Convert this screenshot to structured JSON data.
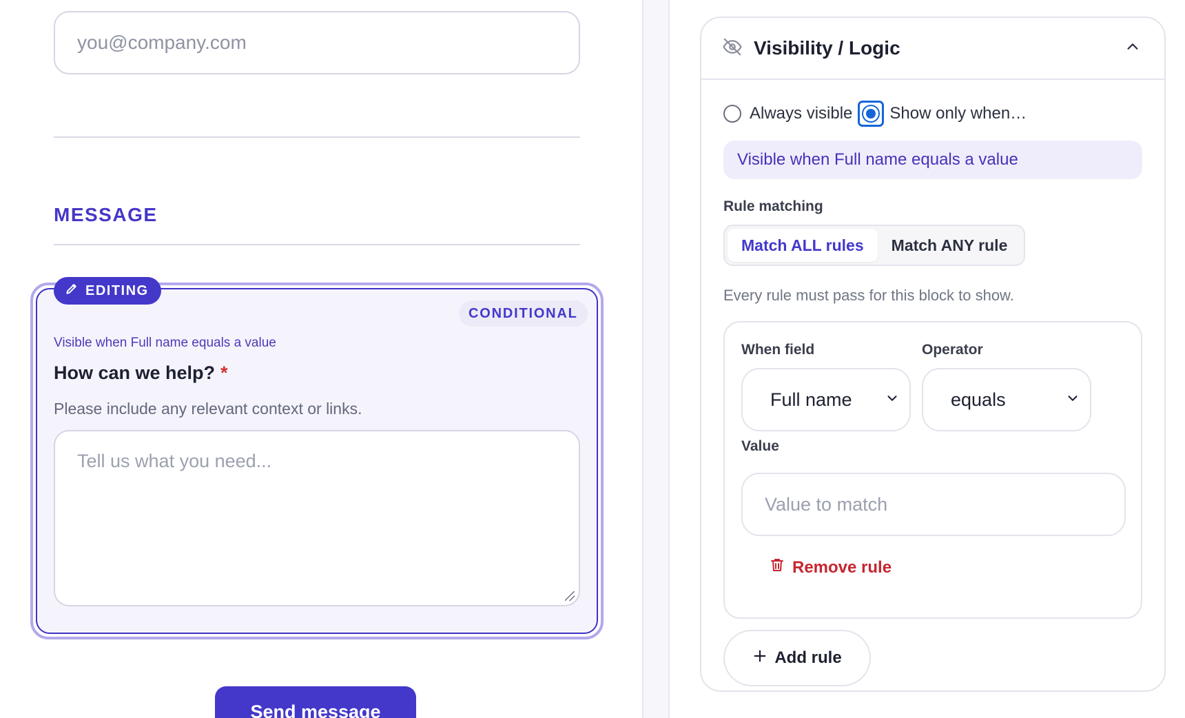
{
  "canvas": {
    "email_placeholder": "you@company.com",
    "section_title": "MESSAGE",
    "editing_badge": "EDITING",
    "conditional_tag": "CONDITIONAL",
    "visible_note": "Visible when Full name equals a value",
    "field_label": "How can we help?",
    "required_mark": "*",
    "field_help": "Please include any relevant context or links.",
    "textarea_placeholder": "Tell us what you need...",
    "send_button": "Send message"
  },
  "panel": {
    "title": "Visibility / Logic",
    "icons": {
      "header": "eye-off-icon",
      "collapse": "chevron-up-icon"
    },
    "visibility_options": [
      {
        "label": "Always visible",
        "selected": false
      },
      {
        "label": "Show only when…",
        "selected": true
      }
    ],
    "summary": "Visible when Full name equals a value",
    "rule_matching_label": "Rule matching",
    "match_options": [
      {
        "label": "Match ALL rules",
        "active": true
      },
      {
        "label": "Match ANY rule",
        "active": false
      }
    ],
    "match_help": "Every rule must pass for this block to show.",
    "rule": {
      "when_field_label": "When field",
      "when_field_value": "Full name",
      "operator_label": "Operator",
      "operator_value": "equals",
      "value_label": "Value",
      "value_placeholder": "Value to match",
      "remove_label": "Remove rule"
    },
    "add_rule_label": "Add rule"
  },
  "colors": {
    "accent": "#4338ca",
    "danger": "#c6262f",
    "focus": "#1565d8"
  }
}
